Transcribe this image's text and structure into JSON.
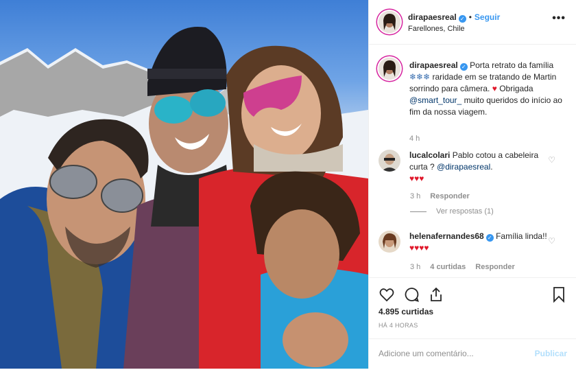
{
  "post": {
    "author": "dirapaesreal",
    "follow_label": "Seguir",
    "separator": "•",
    "location": "Farellones, Chile",
    "more_label": "•••"
  },
  "caption": {
    "author": "dirapaesreal",
    "text_1": "Porta retrato da família",
    "emoji_1": "❄❄❄",
    "text_2": "raridade em se tratando de Martin sorrindo para câmera.",
    "heart": "♥",
    "text_3": "Obrigada",
    "mention": "@smart_tour_",
    "text_4": "muito queridos do início ao fim da nossa viagem.",
    "time": "4 h"
  },
  "comments": [
    {
      "author": "lucalcolari",
      "text": "Pablo cotou a cabeleira curta ?",
      "mention": "@dirapaesreal",
      "suffix": ".",
      "hearts": "♥♥♥",
      "time": "3 h",
      "reply": "Responder",
      "view_replies": "Ver respostas (1)"
    },
    {
      "author": "helenafernandes68",
      "text": "Família linda!!",
      "hearts": "♥♥♥♥",
      "time": "3 h",
      "likes": "4 curtidas",
      "reply": "Responder"
    }
  ],
  "actions": {
    "likes": "4.895 curtidas",
    "timestamp": "HÁ 4 HORAS",
    "comment_placeholder": "Adicione um comentário...",
    "publish": "Publicar"
  },
  "colors": {
    "link": "#003569",
    "accent": "#3897f0",
    "heart": "#e0182b"
  }
}
